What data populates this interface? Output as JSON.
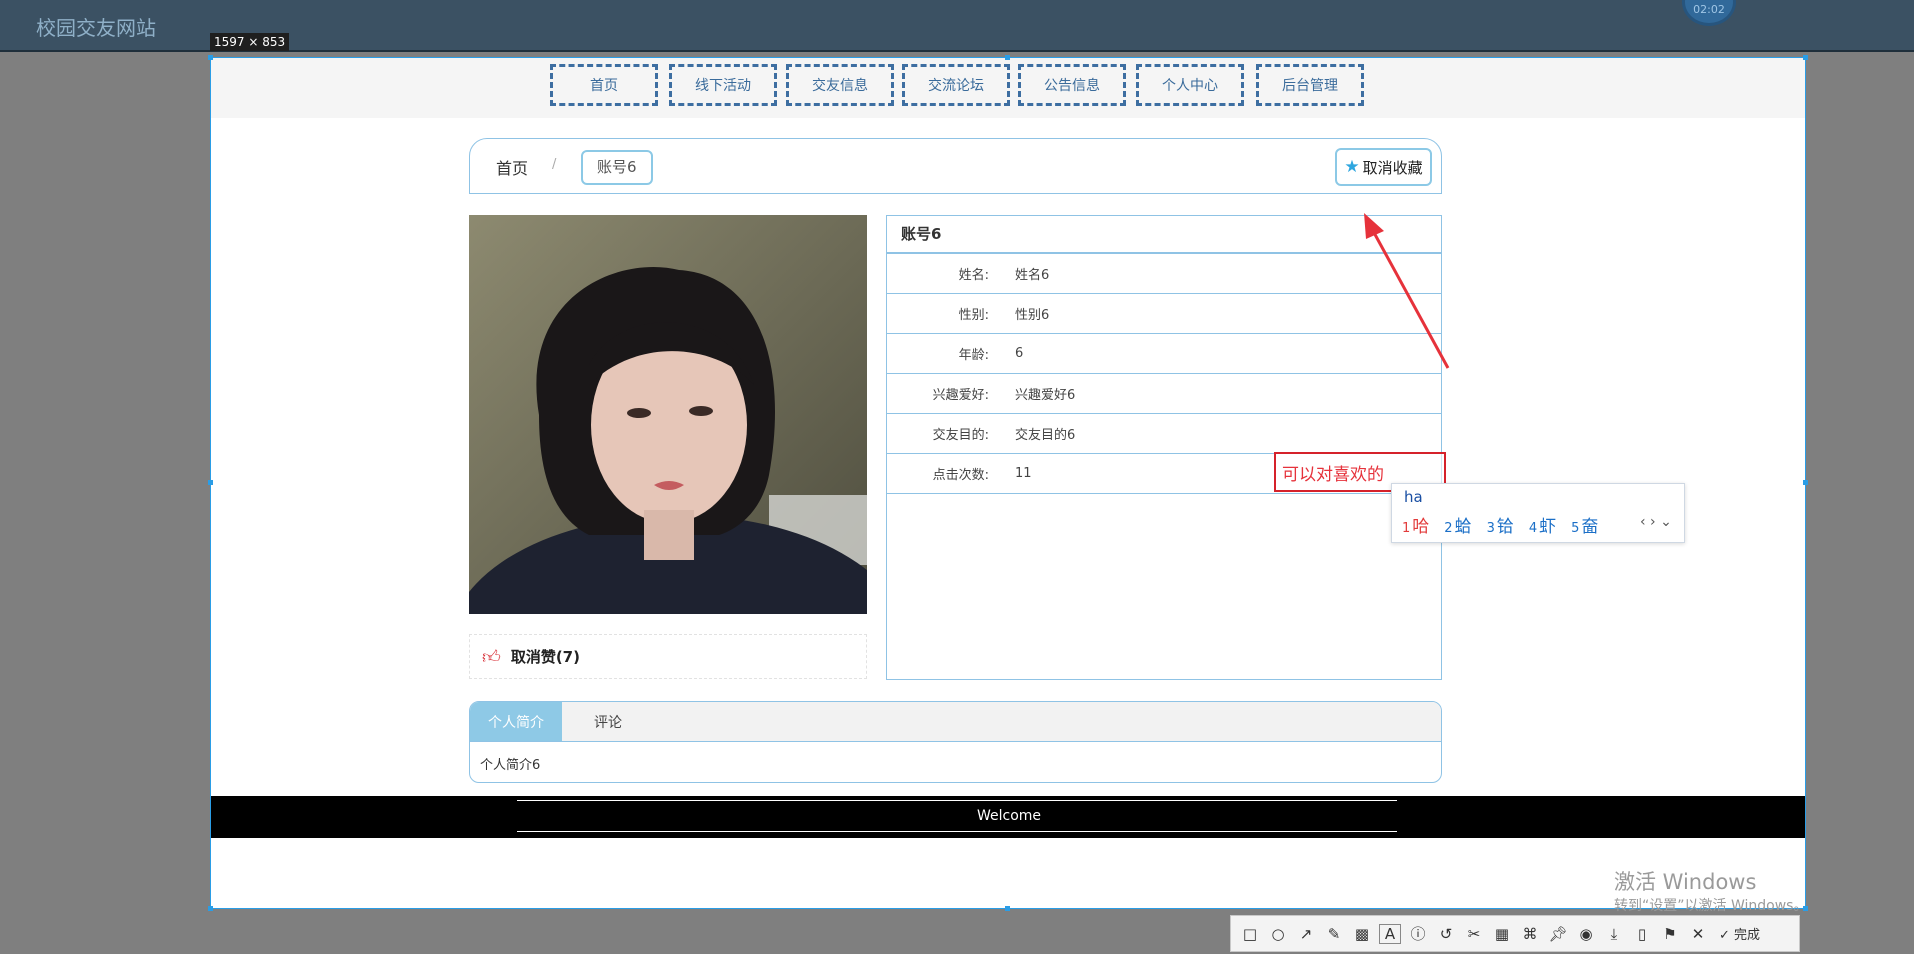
{
  "background": {
    "site_title": "校园交友网站",
    "clock": "02:02"
  },
  "capture": {
    "size_label": "1597 × 853"
  },
  "nav": {
    "items": [
      "首页",
      "线下活动",
      "交友信息",
      "交流论坛",
      "公告信息",
      "个人中心",
      "后台管理"
    ]
  },
  "breadcrumb": {
    "home": "首页",
    "separator": "/",
    "current": "账号6"
  },
  "favorite_button": {
    "icon": "star-icon",
    "label": "取消收藏"
  },
  "like": {
    "icon": "thumbs-up-icon",
    "label": "取消赞(7)"
  },
  "profile": {
    "title": "账号6",
    "fields": [
      {
        "key": "姓名:",
        "value": "姓名6"
      },
      {
        "key": "性别:",
        "value": "性别6"
      },
      {
        "key": "年龄:",
        "value": "6"
      },
      {
        "key": "兴趣爱好:",
        "value": "兴趣爱好6"
      },
      {
        "key": "交友目的:",
        "value": "交友目的6"
      },
      {
        "key": "点击次数:",
        "value": "11"
      }
    ]
  },
  "tabs": {
    "items": [
      "个人简介",
      "评论"
    ],
    "active": 0,
    "content": "个人简介6"
  },
  "footer": {
    "text": "Welcome"
  },
  "annotation": {
    "text": "可以对喜欢的",
    "color": "#e6323b"
  },
  "ime": {
    "input": "ha",
    "candidates": [
      {
        "n": "1",
        "c": "哈"
      },
      {
        "n": "2",
        "c": "蛤"
      },
      {
        "n": "3",
        "c": "铪"
      },
      {
        "n": "4",
        "c": "虾"
      },
      {
        "n": "5",
        "c": "奤"
      }
    ],
    "nav": "‹ › ⌄"
  },
  "watermark": {
    "line1": "激活 Windows",
    "line2": "转到“设置”以激活 Windows。"
  },
  "toolbar": {
    "tools": [
      "rectangle-icon",
      "ellipse-icon",
      "arrow-icon",
      "pen-icon",
      "mosaic-icon",
      "text-icon",
      "number-icon",
      "undo-icon",
      "scissor-icon",
      "ocr-icon",
      "translate-icon",
      "pin-icon",
      "record-icon",
      "download-icon",
      "phone-icon",
      "bookmark-icon",
      "close-icon"
    ],
    "done_label": "完成"
  },
  "colors": {
    "accent": "#8ec9e6",
    "nav_border": "#3d6ea1",
    "annotation_red": "#e6323b"
  }
}
